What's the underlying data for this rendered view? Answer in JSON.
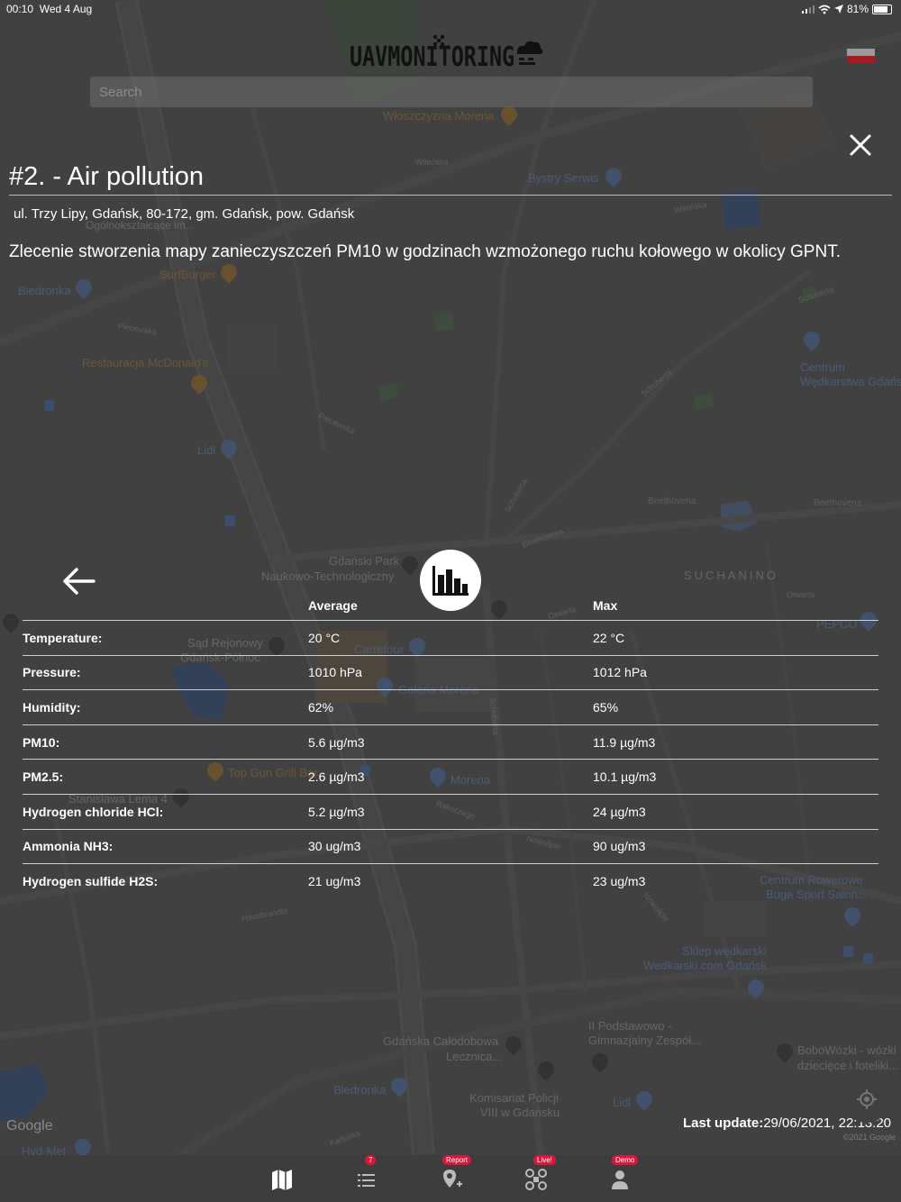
{
  "status_bar": {
    "time": "00:10",
    "date": "Wed 4 Aug",
    "battery": "81%"
  },
  "header": {
    "logo_text": "UAVMONITORING",
    "search_placeholder": "Search"
  },
  "report": {
    "title": "#2. - Air pollution",
    "address": "ul. Trzy Lipy, Gdańsk, 80-172, gm. Gdańsk, pow. Gdańsk",
    "description": "Zlecenie stworzenia mapy zanieczyszczeń PM10 w godzinach wzmożonego ruchu kołowego w okolicy GPNT."
  },
  "stats_table": {
    "columns": [
      "",
      "Average",
      "Max"
    ],
    "rows": [
      {
        "label": "Temperature:",
        "average": "20 °C",
        "max": "22 °C"
      },
      {
        "label": "Pressure:",
        "average": "1010 hPa",
        "max": "1012 hPa"
      },
      {
        "label": "Humidity:",
        "average": "62%",
        "max": "65%"
      },
      {
        "label": "PM10:",
        "average": "5.6 µg/m3",
        "max": "11.9 µg/m3"
      },
      {
        "label": "PM2.5:",
        "average": "2.6 µg/m3",
        "max": "10.1 µg/m3"
      },
      {
        "label": "Hydrogen chloride HCl:",
        "average": "5.2 µg/m3",
        "max": "24 µg/m3"
      },
      {
        "label": "Ammonia NH3:",
        "average": "30 ug/m3",
        "max": "90 ug/m3"
      },
      {
        "label": "Hydrogen sulfide H2S:",
        "average": "21 ug/m3",
        "max": "23 ug/m3"
      }
    ]
  },
  "last_update": {
    "label": "Last update:",
    "value": "29/06/2021, 22:13:20"
  },
  "map": {
    "attribution": "Google",
    "copyright": "©2021 Google",
    "places": [
      "Włoszczyzna Morena",
      "Bystry Serwis",
      "SurfBurger",
      "Biedronka",
      "Restauracja McDonald's",
      "Lidl",
      "Centrum",
      "Wędkarstwa Gdańs",
      "Beethovena",
      "Gdański Park",
      "Naukowo-Technologiczny",
      "SUCHANINO",
      "PEPCO",
      "Sąd Rejonowy",
      "Gdańsk-Północ",
      "Carrefour",
      "Galeria Morena",
      "Top Gun Grill Bar",
      "Morena",
      "Stanisława Lema 4",
      "Centrum Rowerowe",
      "Buga Sport Salon...",
      "Sklep wędkarski",
      "Wedkarski.com Gdańsk",
      "II Podstawowo -",
      "Gimnazjalny Zespół...",
      "Gdańska Całodobowa",
      "Lecznica...",
      "BoboWózki - wózki",
      "dziecięce i foteliki...",
      "Komisariat Policji",
      "VIII w Gdańsku",
      "Hvd-Met",
      "Ogólnokształcące im...",
      "Schuberta",
      "Otwarta",
      "Kartuska",
      "Nowolipie",
      "Rakoczego",
      "Wileńska",
      "Piecewska",
      "Hausbrandta"
    ]
  },
  "bottom_nav": {
    "items": [
      {
        "name": "map",
        "badge": ""
      },
      {
        "name": "list",
        "badge": "7"
      },
      {
        "name": "report",
        "badge": "Report"
      },
      {
        "name": "live",
        "badge": "Live!"
      },
      {
        "name": "demo",
        "badge": "Demo"
      }
    ]
  },
  "colors": {
    "accent_badge": "#d9173c",
    "flag_red": "#a61a24"
  }
}
